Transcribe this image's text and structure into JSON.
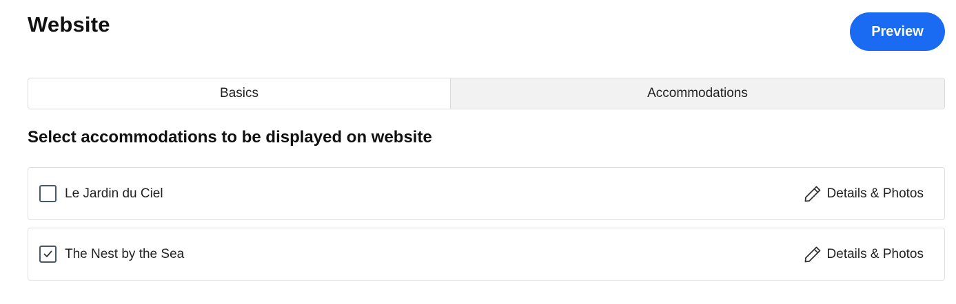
{
  "header": {
    "title": "Website",
    "preview_label": "Preview"
  },
  "tabs": [
    {
      "label": "Basics",
      "active": false
    },
    {
      "label": "Accommodations",
      "active": true
    }
  ],
  "section": {
    "heading": "Select accommodations to be displayed on website"
  },
  "accommodations": [
    {
      "name": "Le Jardin du Ciel",
      "checked": false,
      "action_label": "Details & Photos",
      "action_icon": "pencil-icon"
    },
    {
      "name": "The Nest by the Sea",
      "checked": true,
      "action_label": "Details & Photos",
      "action_icon": "pencil-icon"
    }
  ],
  "colors": {
    "accent": "#1a6af2",
    "active_tab_bg": "#f2f2f2",
    "border": "#dcdcdc"
  }
}
